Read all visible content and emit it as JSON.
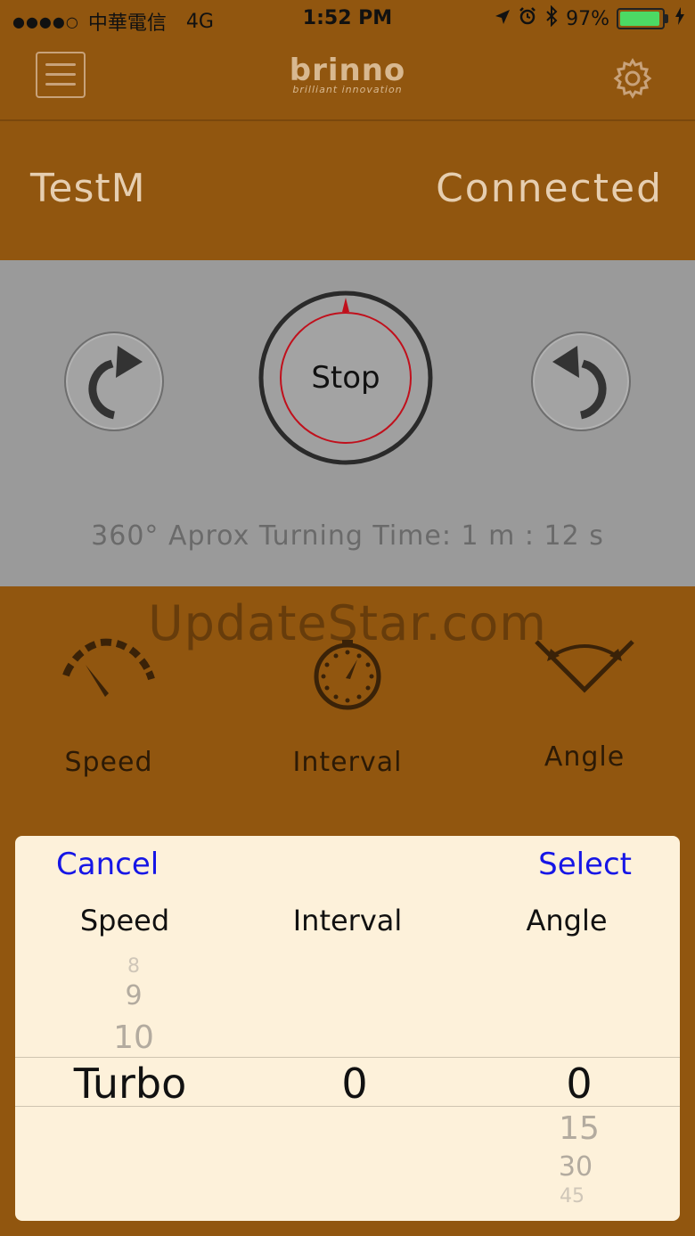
{
  "status_bar": {
    "carrier": "中華電信",
    "network": "4G",
    "time": "1:52 PM",
    "battery": "97%",
    "battery_level": 0.97
  },
  "header": {
    "logo_text": "brinno",
    "logo_tagline": "brilliant innovation"
  },
  "device": {
    "name": "TestM",
    "status": "Connected"
  },
  "control": {
    "stop_label": "Stop",
    "turning_time": "360° Aprox Turning Time: 1 m : 12 s"
  },
  "watermark": "UpdateStar.com",
  "settings": {
    "speed_label": "Speed",
    "interval_label": "Interval",
    "angle_label": "Angle"
  },
  "picker": {
    "cancel_label": "Cancel",
    "select_label": "Select",
    "headers": [
      "Speed",
      "Interval",
      "Angle"
    ],
    "speed_above": [
      "8",
      "9",
      "10"
    ],
    "speed_selected": "Turbo",
    "interval_selected": "0",
    "angle_selected": "0",
    "angle_below": [
      "15",
      "30",
      "45"
    ]
  },
  "colors": {
    "background": "#91560f",
    "panel": "#9a9a9a",
    "sheet": "#fdf1da",
    "link_blue": "#1616e6",
    "dial_red": "#c0101c",
    "battery_green": "#4cd964"
  },
  "icons": [
    "hamburger-menu-icon",
    "gear-icon",
    "rotate-clockwise-icon",
    "rotate-counterclockwise-icon",
    "speedometer-icon",
    "stopwatch-icon",
    "angle-icon",
    "location-arrow-icon",
    "alarm-icon",
    "bluetooth-icon",
    "battery-icon",
    "charging-icon"
  ]
}
